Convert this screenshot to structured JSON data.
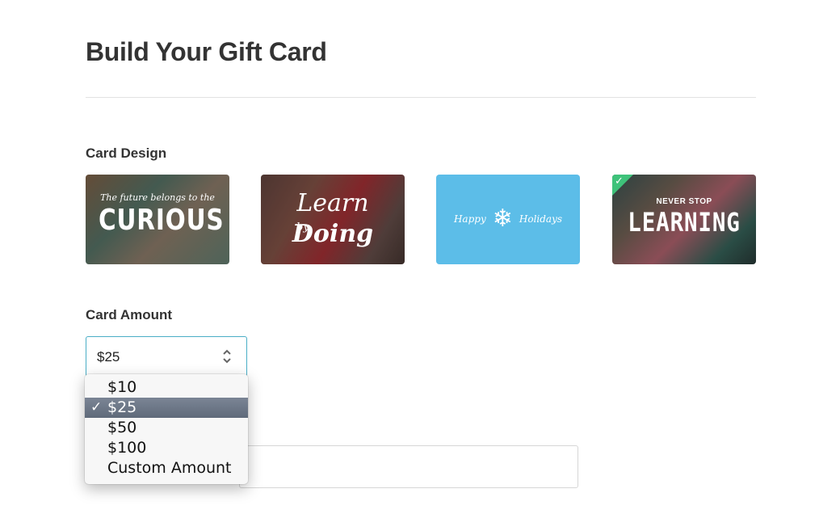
{
  "header": {
    "title": "Build Your Gift Card"
  },
  "design": {
    "label": "Card Design",
    "cards": [
      {
        "line1": "The future belongs to the",
        "line2": "CURIOUS"
      },
      {
        "line1": "Learn",
        "line2": "Doing",
        "connector": "by"
      },
      {
        "left": "Happy",
        "right": "Holidays",
        "icon": "snowflake-icon"
      },
      {
        "line1": "NEVER STOP",
        "line2": "LEARNING",
        "selected": true
      }
    ]
  },
  "amount": {
    "label": "Card Amount",
    "value": "$25",
    "options": [
      "$10",
      "$25",
      "$50",
      "$100",
      "Custom Amount"
    ],
    "selected_option": "$25"
  },
  "glyphs": {
    "check": "✓",
    "selected_check": "✓",
    "snowflake": "❄"
  },
  "colors": {
    "accent": "#4aaec6",
    "selected_badge": "#3ec27a",
    "holiday_card": "#4fb8e6"
  }
}
